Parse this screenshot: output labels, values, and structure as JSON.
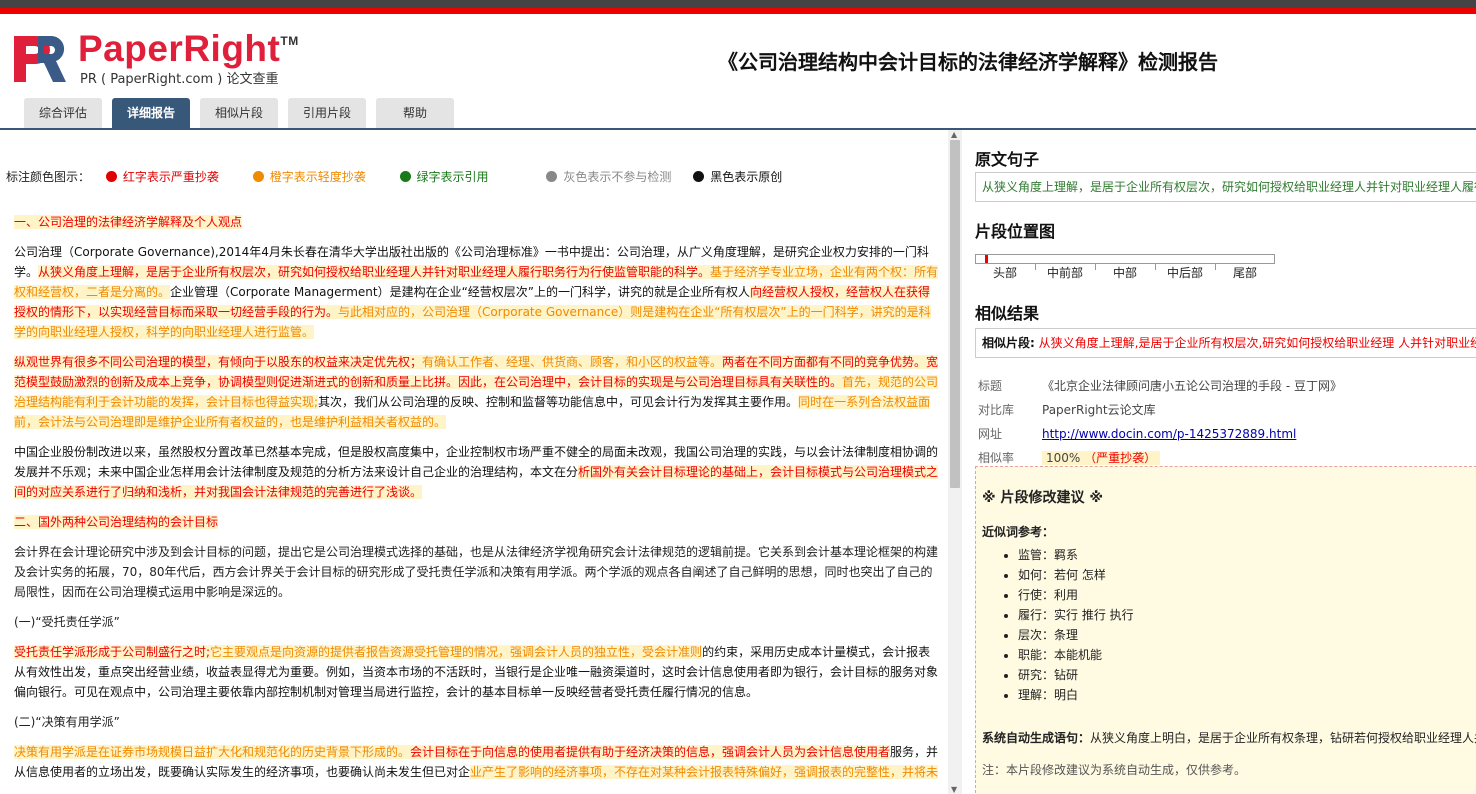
{
  "header": {
    "brand": "PaperRight",
    "tm": "TM",
    "subtitle": "PR ( PaperRight.com ) 论文查重",
    "report_title": "《公司治理结构中会计目标的法律经济学解释》检测报告"
  },
  "tabs": [
    {
      "label": "综合评估",
      "active": false
    },
    {
      "label": "详细报告",
      "active": true
    },
    {
      "label": "相似片段",
      "active": false
    },
    {
      "label": "引用片段",
      "active": false
    },
    {
      "label": "帮助",
      "active": false
    }
  ],
  "legend": {
    "title": "标注颜色图示：",
    "items": [
      {
        "label": "红字表示严重抄袭",
        "color": "#e00000"
      },
      {
        "label": "橙字表示轻度抄袭",
        "color": "#f08a00"
      },
      {
        "label": "绿字表示引用",
        "color": "#1a7a1a"
      },
      {
        "label": "灰色表示不参与检测",
        "color": "#888888"
      },
      {
        "label": "黑色表示原创",
        "color": "#111111"
      }
    ]
  },
  "body": {
    "h1": "一、公司治理的法律经济学解释及个人观点",
    "p1_a": "公司治理（Corporate Governance),2014年4月朱长春在清华大学出版社出版的《公司治理标准》一书中提出：公司治理，从广义角度理解，是研究企业权力安排的一门科学。",
    "p1_b": "从狭义角度上理解，是居于企业所有权层次，研究如何授权给职业经理人并针对职业经理人履行职务行为行使监管职能的科学。",
    "p1_c": "基于经济学专业立场，企业有两个权：所有权和经营权，二者是分离的。",
    "p1_d": "企业管理（Corporate Managerment）是建构在企业“经营权层次”上的一门科学，讲究的就是企业所有权人",
    "p1_e": "向经营权人授权，经营权人在获得授权的情形下，以实现经营目标而采取一切经营手段的行为。",
    "p1_f": "与此相对应的，公司治理（Corporate Governance）则是建构在企业“所有权层次”上的一门科学，讲究的是科学的向职业经理人授权，科学的向职业经理人进行监管。",
    "p2_a": "纵观世界有很多不同公司治理的模型，有倾向于以股东的权益来决定优先权；",
    "p2_b": "有确认工作者、经理、供货商、顾客，和小区的权益等。",
    "p2_c": "两者在不同方面都有不同的竞争优势。宽范模型鼓励激烈的创新及成本上竞争，协调模型则促进渐进式的创新和质量上比拼。因此，在公司治理中，会计目标的实现是与公司治理目标具有关联性的。",
    "p2_d": "首先，规范的公司治理结构能有利于会计功能的发挥，会计目标也得益实现;",
    "p2_e": "其次，我们从公司治理的反映、控制和监督等功能信息中，可见会计行为发挥其主要作用。",
    "p2_f": "同时在一系列合法权益面前，会计法与公司治理即是维护企业所有者权益的，也是维护利益相关者权益的。",
    "p3_a": "中国企业股份制改进以来，虽然股权分置改革已然基本完成，但是股权高度集中，企业控制权市场严重不健全的局面未改观，我国公司治理的实践，与以会计法律制度相协调的发展并不乐观；未来中国企业怎样用会计法律制度及规范的分析方法来设计自己企业的治理结构，本文在分",
    "p3_b": "析国外有关会计目标理论的基础上，会计目标模式与公司治理模式之间的对应关系进行了归纳和浅析，并对我国会计法律规范的完善进行了浅谈。",
    "h2": "二、国外两种公司治理结构的会计目标",
    "p4": "会计界在会计理论研究中涉及到会计目标的问题，提出它是公司治理模式选择的基础，也是从法律经济学视角研究会计法律规范的逻辑前提。它关系到会计基本理论框架的构建及会计实务的拓展，70，80年代后，西方会计界关于会计目标的研究形成了受托责任学派和决策有用学派。两个学派的观点各自阐述了自己鲜明的思想，同时也突出了自己的局限性，因而在公司治理模式运用中影响是深远的。",
    "h3": "(一)“受托责任学派”",
    "p5_a": "受托责任学派形成于公司制盛行之时;",
    "p5_b": "它主要观点是向资源的提供者报告资源受托管理的情况，强调会计人员的独立性，受会计准则",
    "p5_c": "的约束，采用历史成本计量模式，会计报表从有效性出发，重点突出经营业绩，收益表显得尤为重要。例如，当资本市场的不活跃时，当银行是企业唯一融资渠道时，这时会计信息使用者即为银行，会计目标的服务对象偏向银行。可见在观点中，公司治理主要依靠内部控制机制对管理当局进行监控，会计的基本目标单一反映经营者受托责任履行情况的信息。",
    "h4": "(二)“决策有用学派”",
    "p6_a": "决策有用学派是在证券市场规模日益扩大化和规范化的历史背景下形成的。",
    "p6_b": "会计目标在于向信息的使用者提供有助于经济决策的信息，强调会计人员为会计信息使用者",
    "p6_c": "服务，并从信息使用者的立场出发，既要确认实际发生的经济事项，也要确认尚未发生但已对企",
    "p6_d": "业产生了影响的经济事项，不存在对某种会计报表特殊偏好，强调报表的完整性，并将未"
  },
  "right": {
    "orig_title": "原文句子",
    "orig_text": "从狭义角度上理解，是居于企业所有权层次，研究如何授权给职业经理人并针对职业经理人履行职务行为行使监管职能的科学。",
    "pos_title": "片段位置图",
    "pos_labels": [
      "头部",
      "中前部",
      "中部",
      "中后部",
      "尾部"
    ],
    "pos_marker": 0.03,
    "sim_title": "相似结果",
    "sim_label": "相似片段:",
    "sim_text": "从狭义角度上理解,是居于企业所有权层次,研究如何授权给职业经理 人并针对职业经理人履行职务行为行使监管职能的科学",
    "meta": {
      "title_k": "标题",
      "title_v": "《北京企业法律顾问唐小五论公司治理的手段 - 豆丁网》",
      "db_k": "对比库",
      "db_v": "PaperRight云论文库",
      "url_k": "网址",
      "url_v": "http://www.docin.com/p-1425372889.html",
      "rate_k": "相似率",
      "rate_v": "100%",
      "rate_flag": "（严重抄袭）"
    },
    "advice": {
      "title": "※ 片段修改建议 ※",
      "near_label": "近似词参考：",
      "items": [
        "监管：羁系",
        "如何：若何 怎样",
        "行使：利用",
        "履行：实行 推行 执行",
        "层次：条理",
        "职能：本能机能",
        "研究：钻研",
        "理解：明白"
      ],
      "auto_label": "系统自动生成语句：",
      "auto_text": "从狭义角度上明白，是居于企业所有权条理，钻研若何授权给职业经理人并针对职业经理人执行职务行为利用羁系本能机能的科学。",
      "note": "注：本片段修改建议为系统自动生成，仅供参考。"
    }
  }
}
